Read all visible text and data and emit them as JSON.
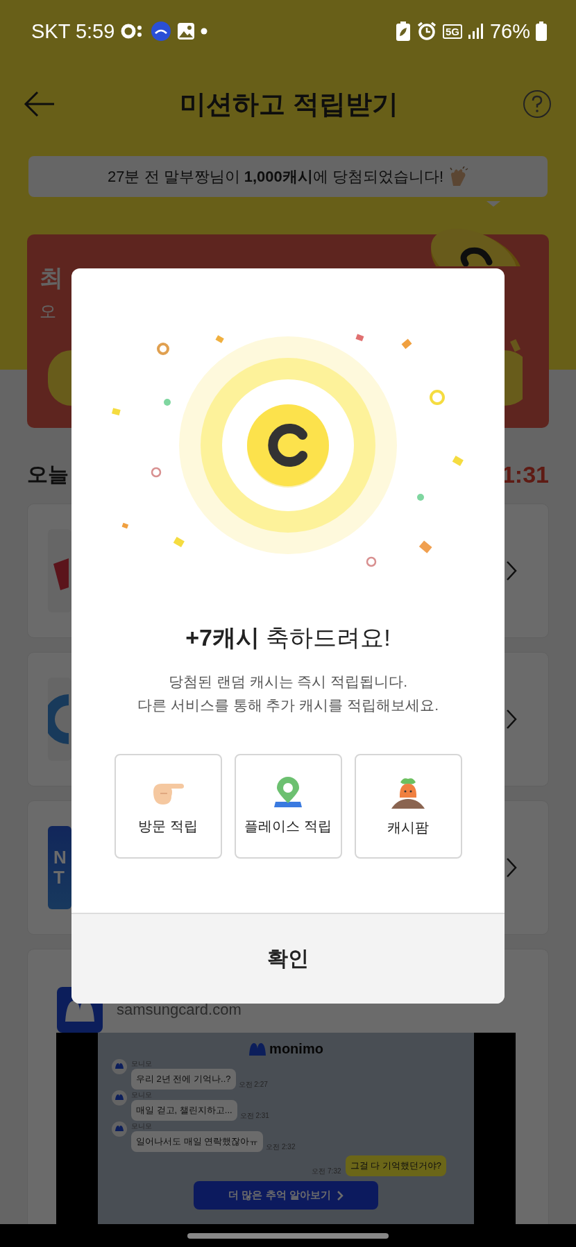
{
  "status_bar": {
    "carrier": "SKT",
    "time": "5:59",
    "network": "5G",
    "battery": "76%"
  },
  "header": {
    "title": "미션하고 적립받기"
  },
  "notice": {
    "text": "27분 전 말부짱님이 **1,000캐시**에 당첨되었습니다!"
  },
  "banner": {
    "title": "최",
    "subtitle": "오"
  },
  "section": {
    "title": "오늘",
    "timer": "1:31"
  },
  "mission_cards": [
    {
      "kind": "logo"
    },
    {
      "kind": "logo"
    },
    {
      "kind": "lettered_logo",
      "logo_lines": [
        "N",
        "T"
      ]
    }
  ],
  "ad_card": {
    "site": "samsungcard.com",
    "brand": "monimo",
    "messages": [
      {
        "mine": false,
        "sender": "모니모",
        "text": "우리 2년 전에 기억나..?",
        "time": "오전 2:27"
      },
      {
        "mine": false,
        "sender": "모니모",
        "text": "매일 걷고, 챌린지하고...",
        "time": "오전 2:31"
      },
      {
        "mine": false,
        "sender": "모니모",
        "text": "일어나서도 매일 연락했잖아ㅠ",
        "time": "오전 2:32"
      },
      {
        "mine": true,
        "text": "그걸 다 기억했던거야?",
        "time": "오전 7:32"
      }
    ],
    "button": "더 많은 추억 알아보기"
  },
  "modal": {
    "title": "**+7캐시** 축하드려요!",
    "description": [
      "당첨된 랜덤 캐시는 즉시 적립됩니다.",
      "다른 서비스를 통해 추가 캐시를 적립해보세요."
    ],
    "options": [
      {
        "kind": "visit",
        "label": "방문 적립"
      },
      {
        "kind": "place",
        "label": "플레이스 적립"
      },
      {
        "kind": "farm",
        "label": "캐시팜"
      }
    ],
    "confirm": "확인"
  }
}
